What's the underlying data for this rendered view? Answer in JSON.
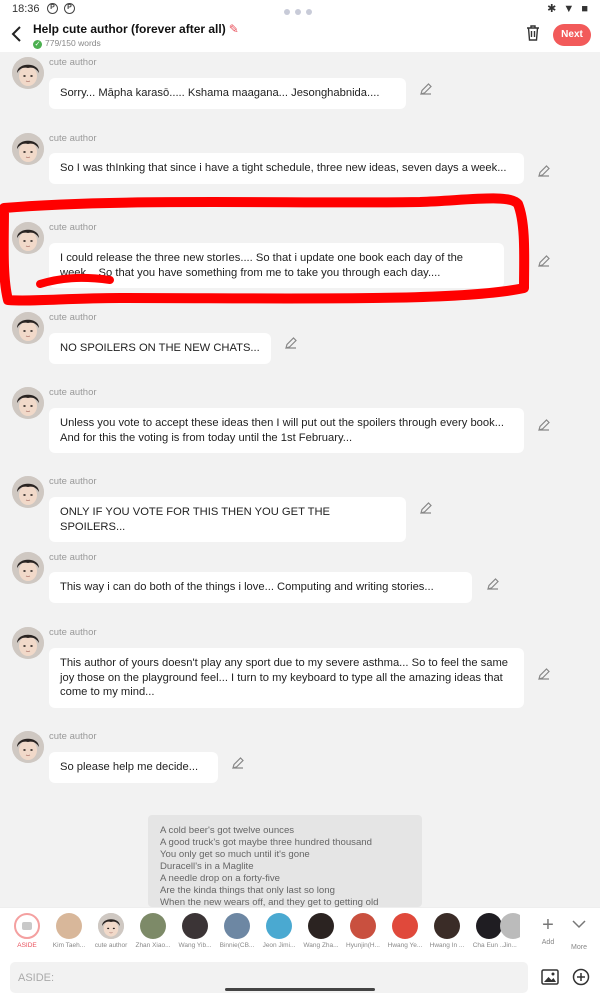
{
  "status_bar": {
    "time": "18:36",
    "icons": [
      "pinterest-icon",
      "pinterest-icon"
    ],
    "system_icons": "✱ ▼ ■"
  },
  "header": {
    "title": "Help cute author (forever after all)",
    "word_count": "779/150 words",
    "next_label": "Next"
  },
  "messages": [
    {
      "sender": "cute author",
      "text": "Sorry... Māpha karasō..... Kshama maagana... Jesonghabnida...."
    },
    {
      "sender": "cute author",
      "text": "So I was thInking that since i have a tight schedule, three new ideas, seven days a week..."
    },
    {
      "sender": "cute author",
      "text": "I could release the three new storIes.... So that i update one book each day of the week... So that you have something from me to take you through each day...."
    },
    {
      "sender": "cute author",
      "text": "NO SPOILERS ON THE NEW CHATS..."
    },
    {
      "sender": "cute author",
      "text": "Unless you vote to accept these ideas then I will put out the spoilers through every book... And for this the voting is from today until the 1st February..."
    },
    {
      "sender": "cute author",
      "text": "ONLY IF YOU VOTE FOR THIS THEN YOU GET THE SPOILERS..."
    },
    {
      "sender": "cute author",
      "text": "This way i can do both of the things i love... Computing and writing stories..."
    },
    {
      "sender": "cute author",
      "text": "This author of yours doesn't play any sport due to my severe asthma... So to feel the same joy those on the playground feel... I turn to my  keyboard to type all the amazing ideas that come to my mind..."
    },
    {
      "sender": "cute author",
      "text": "So please help me decide..."
    }
  ],
  "lyrics": [
    "A cold beer's got twelve ounces",
    "A good truck's got maybe three hundred thousand",
    "You only get so much until it's gone",
    "Duracell's in a Maglite",
    "A needle drop on a forty-five",
    "Are the kinda things that only last so long",
    "When the new wears off, and they get to getting old"
  ],
  "characters": [
    {
      "name": "ASIDE"
    },
    {
      "name": "Kim Taeh..."
    },
    {
      "name": "cute author"
    },
    {
      "name": "Zhan Xiao..."
    },
    {
      "name": "Wang Yib..."
    },
    {
      "name": "Binnie(CB..."
    },
    {
      "name": "Jeon Jimi..."
    },
    {
      "name": "Wang Zha..."
    },
    {
      "name": "Hyunjin(H..."
    },
    {
      "name": "Hwang Ye..."
    },
    {
      "name": "Hwang In ..."
    },
    {
      "name": "Cha Eun ..."
    },
    {
      "name": "Jin..."
    }
  ],
  "tools": {
    "add_label": "Add",
    "more_label": "More"
  },
  "input": {
    "placeholder": "ASIDE:"
  },
  "colors": {
    "accent": "#f25a5a",
    "annotation": "#ff0000",
    "background": "#f2f2f2"
  }
}
